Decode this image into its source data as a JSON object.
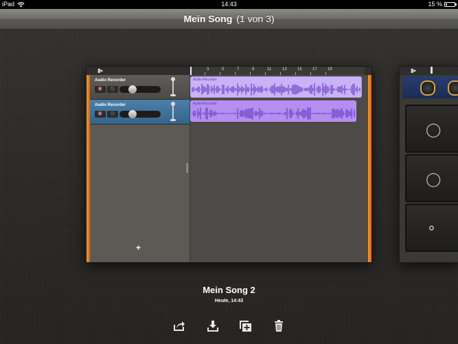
{
  "status_bar": {
    "device": "iPad",
    "time": "14:43",
    "battery_percent": "15 %",
    "battery_level": 0.15
  },
  "nav": {
    "title": "Mein Song",
    "counter": "(1 von 3)"
  },
  "song_card": {
    "ruler": [
      "3",
      "5",
      "7",
      "9",
      "11",
      "13",
      "15",
      "17",
      "19"
    ],
    "tracks": [
      {
        "name": "Audio Recorder",
        "selected": false,
        "volume_level": 0.28
      },
      {
        "name": "Audio Recorder",
        "selected": true,
        "volume_level": 0.28
      }
    ],
    "regions": [
      {
        "label": "Audio Recorder",
        "color": "#c9b3f7"
      },
      {
        "label": "Audio Recorder",
        "color": "#b48ef0"
      }
    ],
    "add_track": "+"
  },
  "song": {
    "title": "Mein Song 2",
    "date": "Heute, 14:43"
  },
  "toolbar": [
    "share-icon",
    "download-icon",
    "duplicate-icon",
    "trash-icon"
  ]
}
